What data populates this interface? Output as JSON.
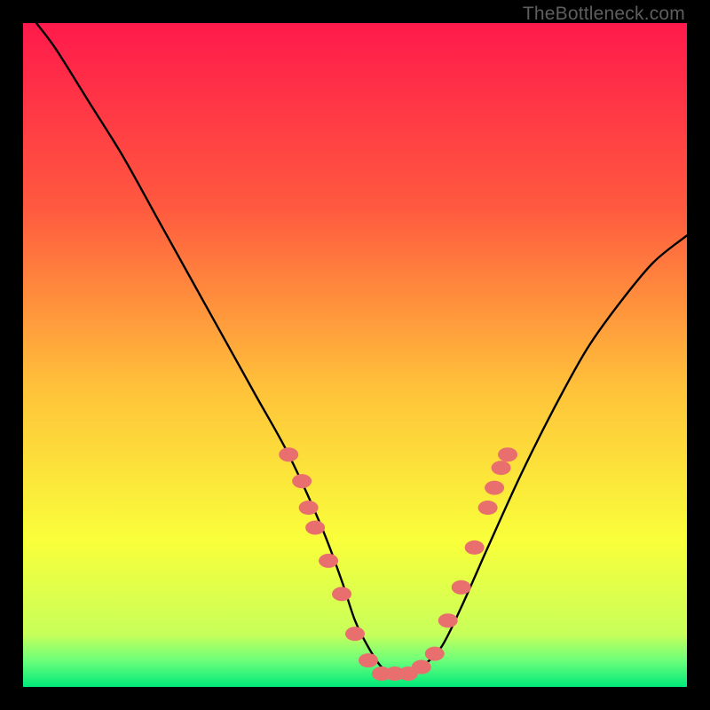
{
  "watermark": "TheBottleneck.com",
  "colors": {
    "background": "#000000",
    "gradient_top": "#ff1a4b",
    "gradient_upper_mid": "#ff6f3a",
    "gradient_mid": "#ffd23a",
    "gradient_lower_mid": "#f6ff3a",
    "gradient_bottom": "#00e97a",
    "curve": "#000000",
    "marker": "#e96f6f",
    "watermark_text": "#5e5e5e"
  },
  "chart_data": {
    "type": "line",
    "title": "",
    "xlabel": "",
    "ylabel": "",
    "xlim": [
      0,
      100
    ],
    "ylim": [
      0,
      100
    ],
    "series": [
      {
        "name": "bottleneck-curve",
        "x": [
          2,
          5,
          10,
          15,
          20,
          25,
          30,
          35,
          40,
          45,
          48,
          50,
          52,
          54,
          56,
          58,
          60,
          63,
          66,
          70,
          75,
          80,
          85,
          90,
          95,
          100
        ],
        "y": [
          100,
          96,
          88,
          80,
          71,
          62,
          53,
          44,
          35,
          24,
          16,
          10,
          6,
          3,
          2,
          2,
          3,
          6,
          12,
          21,
          32,
          42,
          51,
          58,
          64,
          68
        ]
      }
    ],
    "markers": [
      {
        "x": 40,
        "y": 35
      },
      {
        "x": 42,
        "y": 31
      },
      {
        "x": 43,
        "y": 27
      },
      {
        "x": 44,
        "y": 24
      },
      {
        "x": 46,
        "y": 19
      },
      {
        "x": 48,
        "y": 14
      },
      {
        "x": 50,
        "y": 8
      },
      {
        "x": 52,
        "y": 4
      },
      {
        "x": 54,
        "y": 2
      },
      {
        "x": 56,
        "y": 2
      },
      {
        "x": 58,
        "y": 2
      },
      {
        "x": 60,
        "y": 3
      },
      {
        "x": 62,
        "y": 5
      },
      {
        "x": 64,
        "y": 10
      },
      {
        "x": 66,
        "y": 15
      },
      {
        "x": 68,
        "y": 21
      },
      {
        "x": 70,
        "y": 27
      },
      {
        "x": 71,
        "y": 30
      },
      {
        "x": 72,
        "y": 33
      },
      {
        "x": 73,
        "y": 35
      }
    ],
    "gradient_stops": [
      {
        "offset": 0.0,
        "color": "#ff1a4b"
      },
      {
        "offset": 0.28,
        "color": "#ff5a3f"
      },
      {
        "offset": 0.55,
        "color": "#ffc23a"
      },
      {
        "offset": 0.78,
        "color": "#f9ff3a"
      },
      {
        "offset": 0.92,
        "color": "#c8ff5a"
      },
      {
        "offset": 0.96,
        "color": "#6dff7a"
      },
      {
        "offset": 1.0,
        "color": "#00e97a"
      }
    ]
  }
}
